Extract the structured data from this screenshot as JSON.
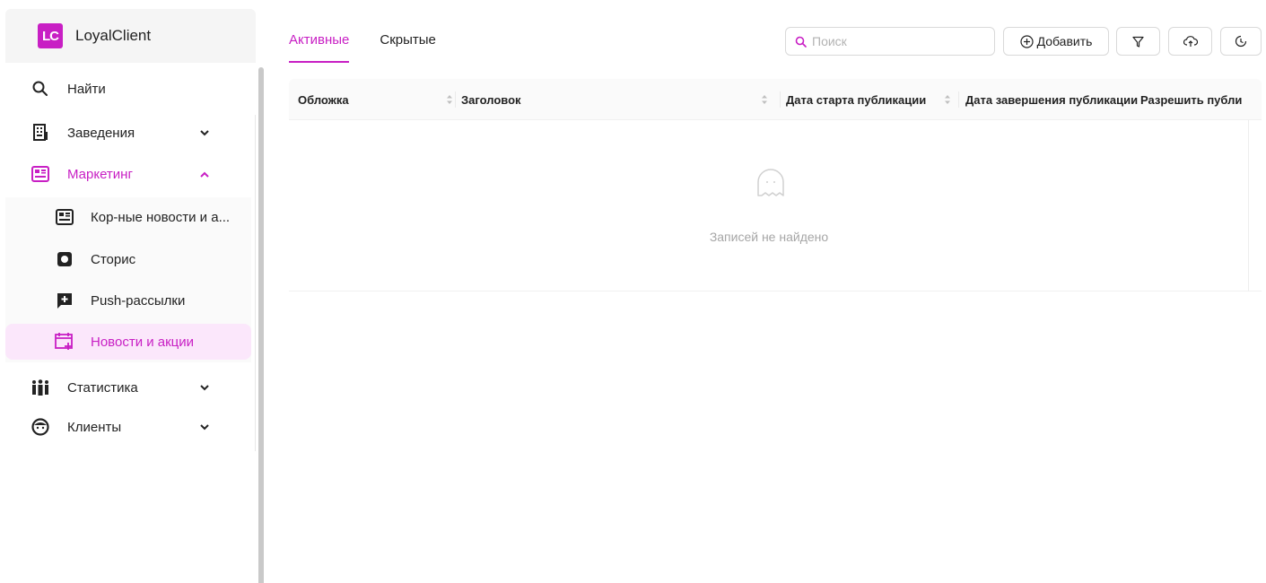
{
  "brand": {
    "logo_text": "LC",
    "name": "LoyalClient"
  },
  "sidebar": {
    "items": [
      {
        "label": "Найти",
        "icon": "search-icon"
      },
      {
        "label": "Заведения",
        "icon": "building-icon"
      },
      {
        "label": "Маркетинг",
        "icon": "newspaper-icon"
      },
      {
        "label": "Статистика",
        "icon": "people-icon"
      },
      {
        "label": "Клиенты",
        "icon": "face-icon"
      }
    ],
    "marketing_sub": [
      {
        "label": "Кор-ные новости и а...",
        "icon": "newspaper-icon"
      },
      {
        "label": "Сторис",
        "icon": "stories-icon"
      },
      {
        "label": "Push-рассылки",
        "icon": "push-icon"
      },
      {
        "label": "Новости и акции",
        "icon": "calendar-plus-icon"
      }
    ]
  },
  "tabs": [
    {
      "label": "Активные"
    },
    {
      "label": "Скрытые"
    }
  ],
  "toolbar": {
    "search_placeholder": "Поиск",
    "add_label": "Добавить"
  },
  "table": {
    "columns": [
      "Обложка",
      "Заголовок",
      "Дата старта публикации",
      "Дата завершения публикации",
      "Разрешить публи"
    ],
    "empty_text": "Записей не найдено"
  },
  "colors": {
    "accent": "#c81fc4",
    "selected_bg": "#fbe7fb"
  }
}
